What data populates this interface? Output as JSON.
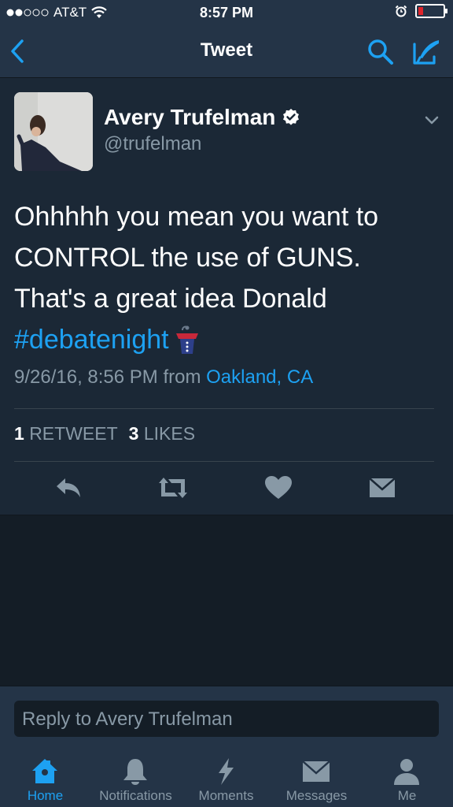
{
  "status_bar": {
    "carrier": "AT&T",
    "time": "8:57 PM"
  },
  "nav": {
    "title": "Tweet"
  },
  "tweet": {
    "author_name": "Avery Trufelman",
    "handle": "@trufelman",
    "text_line1": "Ohhhhh you mean you want to",
    "text_line2": "CONTROL the use of GUNS.",
    "text_line3": "That's a great idea Donald",
    "hashtag": "#debatenight",
    "timestamp": "9/26/16, 8:56 PM from",
    "location": "Oakland, CA",
    "retweet_count": "1",
    "retweet_label": "RETWEET",
    "like_count": "3",
    "like_label": "LIKES"
  },
  "reply": {
    "placeholder": "Reply to Avery Trufelman"
  },
  "tabs": [
    {
      "label": "Home",
      "icon": "home-icon"
    },
    {
      "label": "Notifications",
      "icon": "bell-icon"
    },
    {
      "label": "Moments",
      "icon": "lightning-icon"
    },
    {
      "label": "Messages",
      "icon": "envelope-icon"
    },
    {
      "label": "Me",
      "icon": "person-icon"
    }
  ],
  "colors": {
    "accent": "#1da1f2",
    "background": "#141d26",
    "card": "#1b2836",
    "bar": "#243447",
    "muted": "#8899a6",
    "battery_low": "#e0252b"
  }
}
